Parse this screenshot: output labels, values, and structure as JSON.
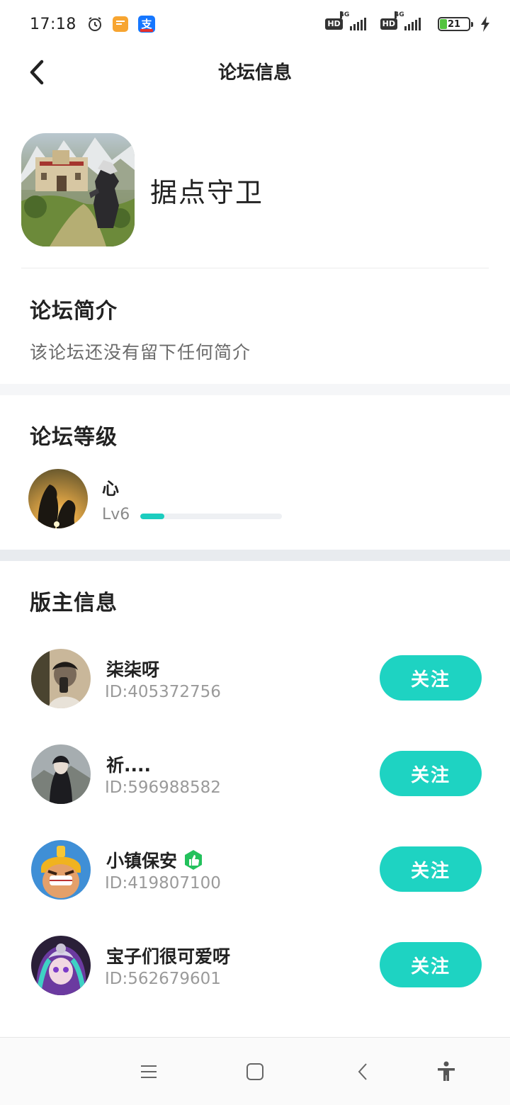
{
  "status_bar": {
    "time": "17:18",
    "battery_level": "21",
    "network_1": "4G",
    "network_2": "4G",
    "hd_label": "HD"
  },
  "header": {
    "title": "论坛信息",
    "back_icon": "chevron-left-icon"
  },
  "forum": {
    "name": "据点守卫"
  },
  "intro": {
    "title": "论坛简介",
    "text": "该论坛还没有留下任何简介"
  },
  "level": {
    "title": "论坛等级",
    "user_name": "心",
    "level_label": "Lv6",
    "progress": 0.17
  },
  "moderators": {
    "title": "版主信息",
    "follow_label": "关注",
    "items": [
      {
        "name": "柒柒呀",
        "id": "ID:405372756"
      },
      {
        "name": "祈....",
        "id": "ID:596988582"
      },
      {
        "name": "小镇保安",
        "id": "ID:419807100"
      },
      {
        "name": "宝子们很可爱呀",
        "id": "ID:562679601"
      }
    ]
  },
  "colors": {
    "accent": "#1ed3c2",
    "band_light": "#f5f6f8",
    "band_dark": "#e8ebef"
  },
  "nav": {
    "icons": [
      "menu-icon",
      "home-square-icon",
      "back-triangle-icon",
      "accessibility-icon"
    ]
  }
}
